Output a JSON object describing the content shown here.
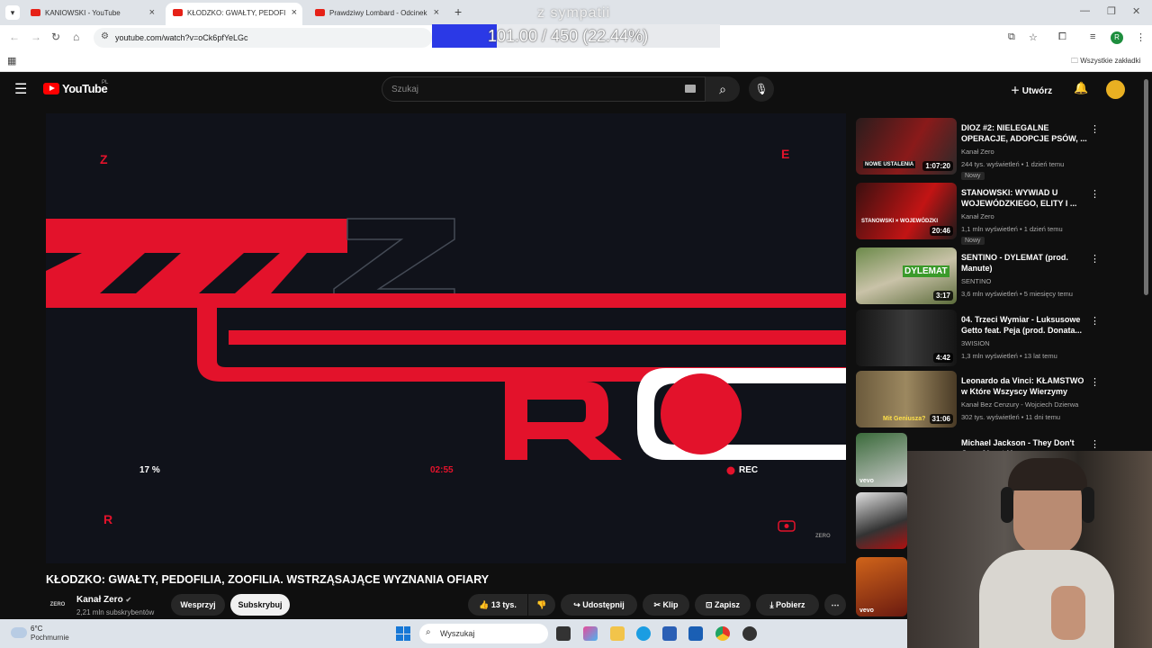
{
  "browser": {
    "tabs": [
      {
        "title": "KANIOWSKI - YouTube"
      },
      {
        "title": "KŁODZKO: GWAŁTY, PEDOFILIA"
      },
      {
        "title": "Prawdziwy Lombard - Odcinek"
      }
    ],
    "url": "youtube.com/watch?v=oCk6pfYeLGc",
    "profile_initial": "R",
    "bookmarks_label": "Wszystkie zakładki"
  },
  "overlay": {
    "title": "z sympatii",
    "progress_text": "101.00 / 450 (22.44%)",
    "progress_fraction": 0.2244
  },
  "youtube": {
    "logo_text": "YouTube",
    "country_code": "PL",
    "search_placeholder": "Szukaj",
    "create_label": "Utwórz"
  },
  "video": {
    "overlay_percent": "17 %",
    "overlay_time": "02:55",
    "overlay_rec": "REC",
    "corner_tl": "Z",
    "corner_tr": "E",
    "corner_bl": "R",
    "watermark": "ZERO",
    "title": "KŁODZKO: GWAŁTY, PEDOFILIA, ZOOFILIA. WSTRZĄSAJĄCE WYZNANIA OFIARY",
    "channel_logo_text": "ZERO",
    "channel": "Kanał Zero",
    "subscribers": "2,21 mln subskrybentów",
    "support_label": "Wesprzyj",
    "subscribe_label": "Subskrybuj",
    "likes": "13 tys.",
    "share_label": "Udostępnij",
    "clip_label": "Klip",
    "save_label": "Zapisz",
    "download_label": "Pobierz"
  },
  "recommendations": [
    {
      "title": "DIOZ #2: NIELEGALNE OPERACJE, ADOPCJE PSÓW, ...",
      "channel": "Kanał Zero",
      "views": "244 tys. wyświetleń • 1 dzień temu",
      "duration": "1:07:20",
      "badge": "Nowy"
    },
    {
      "title": "STANOWSKI: WYWIAD U WOJEWÓDZKIEGO, ELITY I ...",
      "channel": "Kanał Zero",
      "views": "1,1 mln wyświetleń • 1 dzień temu",
      "duration": "20:46",
      "badge": "Nowy"
    },
    {
      "title": "SENTINO - DYLEMAT (prod. Manute)",
      "channel": "SENTINO",
      "views": "3,6 mln wyświetleń • 5 miesięcy temu",
      "duration": "3:17"
    },
    {
      "title": "04. Trzeci Wymiar - Luksusowe Getto feat. Peja (prod. Donata...",
      "channel": "3WISION",
      "views": "1,3 mln wyświetleń • 13 lat temu",
      "duration": "4:42"
    },
    {
      "title": "Leonardo da Vinci: KŁAMSTWO w Które Wszyscy Wierzymy",
      "channel": "Kanał Bez Cenzury - Wojciech Dzierwa",
      "views": "302 tys. wyświetleń • 11 dni temu",
      "duration": "31:06"
    },
    {
      "title": "Michael Jackson - They Don't Care About Us",
      "channel": "",
      "views": "",
      "duration": ""
    }
  ],
  "thumb_texts": {
    "rec0": "NOWE USTALENIA",
    "rec1": "STANOWSKI × WOJEWÓDZKI",
    "rec2": "DYLEMAT",
    "rec4": "Mit Geniusza?",
    "vevo": "vevo"
  },
  "taskbar": {
    "temp": "6°C",
    "weather": "Pochmurnie",
    "search_placeholder": "Wyszukaj"
  },
  "colors": {
    "accent_red": "#e3122b",
    "overlay_blue": "#2b39e6",
    "yt_bg": "#0f0f0f"
  }
}
